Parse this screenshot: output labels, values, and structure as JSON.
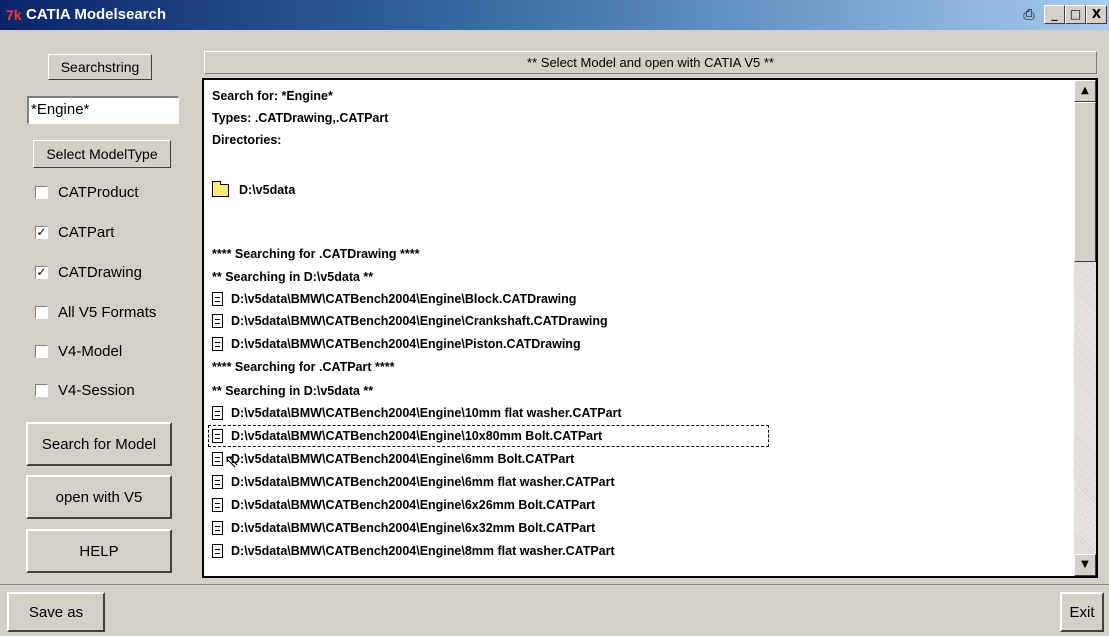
{
  "window": {
    "title": "CATIA Modelsearch",
    "logo": "7k",
    "controls": {
      "print_icon": "print-icon",
      "minimize": "_",
      "maximize": "□",
      "close": "X"
    }
  },
  "left_panel": {
    "searchstring_label": "Searchstring",
    "search_value": "*Engine*",
    "select_modeltype_label": "Select ModelType",
    "checkboxes": [
      {
        "label": "CATProduct",
        "checked": false
      },
      {
        "label": "CATPart",
        "checked": true
      },
      {
        "label": "CATDrawing",
        "checked": true
      },
      {
        "label": "All V5 Formats",
        "checked": false
      },
      {
        "label": "V4-Model",
        "checked": false
      },
      {
        "label": "V4-Session",
        "checked": false
      }
    ],
    "search_button": "Search for Model",
    "open_button": "open with V5",
    "help_button": "HELP"
  },
  "results": {
    "header": "** Select Model and open with CATIA V5 **",
    "lines": [
      {
        "text": "Search for: *Engine*",
        "icon": "none"
      },
      {
        "text": "Types: .CATDrawing,.CATPart",
        "icon": "none"
      },
      {
        "text": "Directories:",
        "icon": "none"
      },
      {
        "text": "D:\\v5data",
        "icon": "folder"
      },
      {
        "text": "**** Searching for .CATDrawing ****",
        "icon": "none"
      },
      {
        "text": "** Searching in D:\\v5data **",
        "icon": "none"
      },
      {
        "text": "D:\\v5data\\BMW\\CATBench2004\\Engine\\Block.CATDrawing",
        "icon": "file"
      },
      {
        "text": "D:\\v5data\\BMW\\CATBench2004\\Engine\\Crankshaft.CATDrawing",
        "icon": "file"
      },
      {
        "text": "D:\\v5data\\BMW\\CATBench2004\\Engine\\Piston.CATDrawing",
        "icon": "file"
      },
      {
        "text": "**** Searching for .CATPart ****",
        "icon": "none"
      },
      {
        "text": "** Searching in D:\\v5data **",
        "icon": "none"
      },
      {
        "text": "D:\\v5data\\BMW\\CATBench2004\\Engine\\10mm flat washer.CATPart",
        "icon": "file"
      },
      {
        "text": "D:\\v5data\\BMW\\CATBench2004\\Engine\\10x80mm Bolt.CATPart",
        "icon": "file",
        "selected": true
      },
      {
        "text": "D:\\v5data\\BMW\\CATBench2004\\Engine\\6mm Bolt.CATPart",
        "icon": "file"
      },
      {
        "text": "D:\\v5data\\BMW\\CATBench2004\\Engine\\6mm flat washer.CATPart",
        "icon": "file"
      },
      {
        "text": "D:\\v5data\\BMW\\CATBench2004\\Engine\\6x26mm Bolt.CATPart",
        "icon": "file"
      },
      {
        "text": "D:\\v5data\\BMW\\CATBench2004\\Engine\\6x32mm Bolt.CATPart",
        "icon": "file"
      },
      {
        "text": "D:\\v5data\\BMW\\CATBench2004\\Engine\\8mm flat washer.CATPart",
        "icon": "file"
      }
    ]
  },
  "bottom": {
    "save_as": "Save as",
    "exit": "Exit"
  }
}
